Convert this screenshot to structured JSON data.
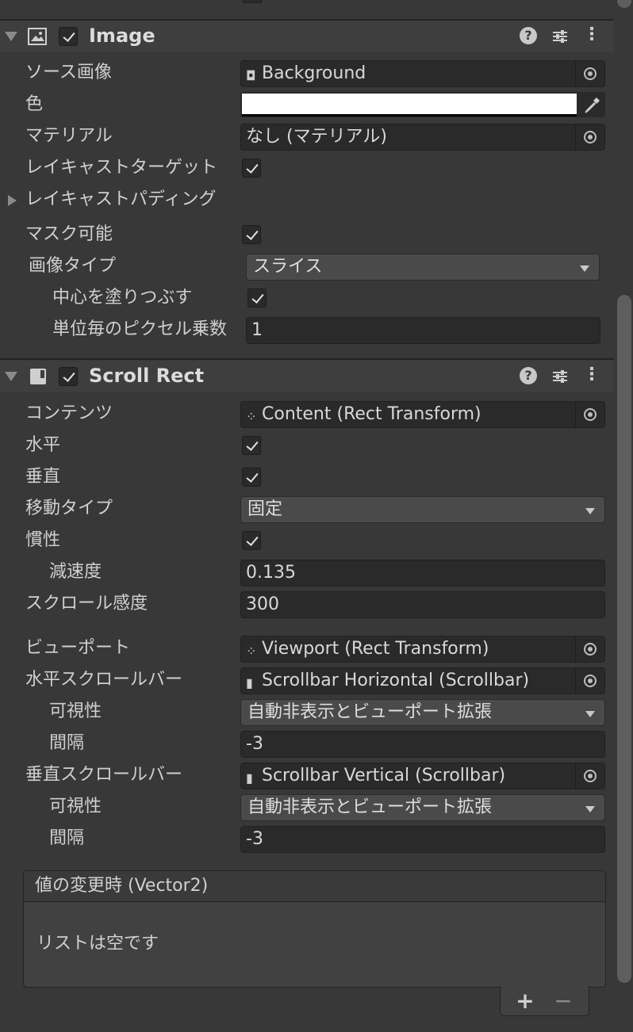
{
  "image_component": {
    "title": "Image",
    "properties": {
      "source_image": {
        "label": "ソース画像",
        "value": "Background"
      },
      "color": {
        "label": "色",
        "value": "#ffffff"
      },
      "material": {
        "label": "マテリアル",
        "value": "なし (マテリアル)"
      },
      "raycast_target": {
        "label": "レイキャストターゲット",
        "checked": true
      },
      "raycast_padding": {
        "label": "レイキャストパディング"
      },
      "maskable": {
        "label": "マスク可能",
        "checked": true
      },
      "image_type": {
        "label": "画像タイプ",
        "value": "スライス"
      },
      "fill_center": {
        "label": "中心を塗りつぶす",
        "checked": true
      },
      "pixels_per_unit": {
        "label": "単位毎のピクセル乗数",
        "value": "1"
      }
    }
  },
  "scroll_rect": {
    "title": "Scroll Rect",
    "properties": {
      "content": {
        "label": "コンテンツ",
        "value": "Content (Rect Transform)"
      },
      "horizontal": {
        "label": "水平",
        "checked": true
      },
      "vertical": {
        "label": "垂直",
        "checked": true
      },
      "movement_type": {
        "label": "移動タイプ",
        "value": "固定"
      },
      "inertia": {
        "label": "慣性",
        "checked": true
      },
      "deceleration": {
        "label": "減速度",
        "value": "0.135"
      },
      "scroll_sensitivity": {
        "label": "スクロール感度",
        "value": "300"
      },
      "viewport": {
        "label": "ビューポート",
        "value": "Viewport (Rect Transform)"
      },
      "h_scrollbar": {
        "label": "水平スクロールバー",
        "value": "Scrollbar Horizontal (Scrollbar)"
      },
      "h_visibility": {
        "label": "可視性",
        "value": "自動非表示とビューポート拡張"
      },
      "h_spacing": {
        "label": "間隔",
        "value": "-3"
      },
      "v_scrollbar": {
        "label": "垂直スクロールバー",
        "value": "Scrollbar Vertical (Scrollbar)"
      },
      "v_visibility": {
        "label": "可視性",
        "value": "自動非表示とビューポート拡張"
      },
      "v_spacing": {
        "label": "間隔",
        "value": "-3"
      }
    },
    "event": {
      "title": "値の変更時 (Vector2)",
      "empty_text": "リストは空です",
      "add": "+",
      "remove": "−"
    }
  },
  "icons": {
    "help": "?",
    "settings": "sliders-icon",
    "more": "⋮"
  }
}
